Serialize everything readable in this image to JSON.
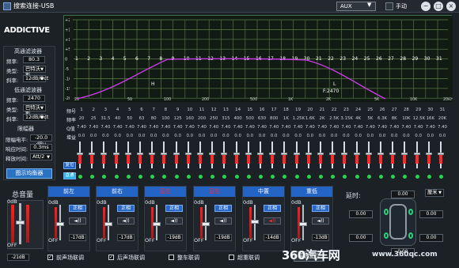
{
  "window": {
    "title": "搜索连接-USB",
    "source": "AUX",
    "mode": "手动"
  },
  "brand": {
    "logo": "ADDICTIVE"
  },
  "left": {
    "hp_title": "高通滤波器",
    "hp_freq_label": "频率:",
    "hp_freq": "80.3",
    "hp_type_label": "类型:",
    "hp_type": "巴特沃斯",
    "hp_slope_label": "斜率:",
    "hp_slope": "12dB/Oct",
    "lp_title": "低通滤波器",
    "lp_freq_label": "频率:",
    "lp_freq": "2470",
    "lp_type_label": "类型:",
    "lp_type": "巴特沃斯",
    "lp_slope_label": "斜率:",
    "lp_slope": "12dB/Oct",
    "limiter_title": "限幅器",
    "limit_level_label": "限幅电平:",
    "limit_level": "-20.0 dBu",
    "attack_label": "响应时间:",
    "attack": "0.3ms",
    "release_label": "释放时间:",
    "release": "Att/2",
    "eq_button": "图示均衡器"
  },
  "graph": {
    "y_labels": [
      "+20",
      "+15",
      "+10",
      "+5",
      "0",
      "-5",
      "-10",
      "-15",
      "-20"
    ],
    "x_labels": [
      "20",
      "50",
      "100",
      "200",
      "500",
      "1K",
      "2K",
      "5K",
      "10K",
      "20KHz"
    ],
    "band_numbers": [
      "1",
      "2",
      "3",
      "4",
      "5",
      "6",
      "7",
      "8",
      "9",
      "10",
      "11",
      "12",
      "13",
      "14",
      "15",
      "16",
      "17",
      "18",
      "19",
      "20",
      "21",
      "22",
      "23",
      "24",
      "25",
      "26",
      "27",
      "28",
      "29",
      "30",
      "31"
    ],
    "h_label": "H",
    "l_label": "L",
    "lp_marker": "F:2470"
  },
  "eq": {
    "row_labels": [
      "频号",
      "频率",
      "Q值",
      "增益"
    ],
    "bands": [
      "1",
      "2",
      "3",
      "4",
      "5",
      "6",
      "7",
      "8",
      "9",
      "10",
      "11",
      "12",
      "13",
      "14",
      "15",
      "16",
      "17",
      "18",
      "19",
      "20",
      "21",
      "22",
      "23",
      "24",
      "25",
      "26",
      "27",
      "28",
      "29",
      "30",
      "31"
    ],
    "freqs": [
      "20",
      "25",
      "31.5",
      "40",
      "50",
      "63",
      "80",
      "100",
      "125",
      "160",
      "200",
      "250",
      "315",
      "400",
      "500",
      "630",
      "800",
      "1K",
      "1.25K",
      "1.6K",
      "2K",
      "2.5K",
      "3.15K",
      "4K",
      "5K",
      "6.3K",
      "8K",
      "10K",
      "12.5K",
      "16K",
      "20K"
    ],
    "q": [
      "7.40",
      "7.40",
      "7.40",
      "7.40",
      "7.40",
      "7.40",
      "7.40",
      "7.40",
      "7.40",
      "7.40",
      "7.40",
      "7.40",
      "7.40",
      "7.40",
      "7.40",
      "7.40",
      "7.40",
      "7.40",
      "7.40",
      "7.40",
      "7.40",
      "7.40",
      "7.40",
      "7.40",
      "7.40",
      "7.40",
      "7.40",
      "7.40",
      "7.40",
      "7.40",
      "7.40"
    ],
    "gain": [
      "0.0",
      "0.0",
      "0.0",
      "0.0",
      "0.0",
      "0.0",
      "0.0",
      "0.0",
      "0.0",
      "0.0",
      "0.0",
      "0.0",
      "0.0",
      "0.0",
      "0.0",
      "0.0",
      "0.0",
      "0.0",
      "0.0",
      "0.0",
      "0.0",
      "0.0",
      "0.0",
      "0.0",
      "0.0",
      "0.0",
      "0.0",
      "0.0",
      "0.0",
      "0.0",
      "0.0"
    ],
    "phase_label": "复位",
    "bypass_label": "直通"
  },
  "master": {
    "title": "总音量",
    "value": "-21dB",
    "scale_top": "0dB",
    "scale_bottom": "OFF"
  },
  "channels": [
    {
      "name": "前左",
      "status": "正相",
      "sound": "◄))",
      "db": "-17dB",
      "scale_top": "0dB",
      "scale_bottom": "OFF"
    },
    {
      "name": "前右",
      "status": "正相",
      "sound": "◄))",
      "db": "-17dB",
      "scale_top": "0dB",
      "scale_bottom": "OFF"
    },
    {
      "name": "后左",
      "status": "正相",
      "sound": "◄))",
      "db": "-19dB",
      "scale_top": "0dB",
      "scale_bottom": "OFF"
    },
    {
      "name": "后右",
      "status": "正相",
      "sound": "◄))",
      "db": "-19dB",
      "scale_top": "0dB",
      "scale_bottom": "OFF"
    },
    {
      "name": "中置",
      "status": "正相",
      "sound": "◄))",
      "db": "-14dB",
      "scale_top": "0dB",
      "scale_bottom": "OFF"
    },
    {
      "name": "重低",
      "status": "正相",
      "sound": "◄))",
      "db": "-13dB",
      "scale_top": "0dB",
      "scale_bottom": "OFF"
    }
  ],
  "link": {
    "front": "前声场联调",
    "rear": "后声场联调",
    "car": "整车联调",
    "sub": "超重联调",
    "reset": "系统复位"
  },
  "delay": {
    "title": "延时:",
    "unit": "厘米",
    "values": [
      "0.00",
      "0.00",
      "0.00",
      "0.00",
      "0.00",
      "0.00"
    ]
  },
  "watermark": {
    "brand": "360汽车网",
    "url": "www.360qc.com"
  }
}
